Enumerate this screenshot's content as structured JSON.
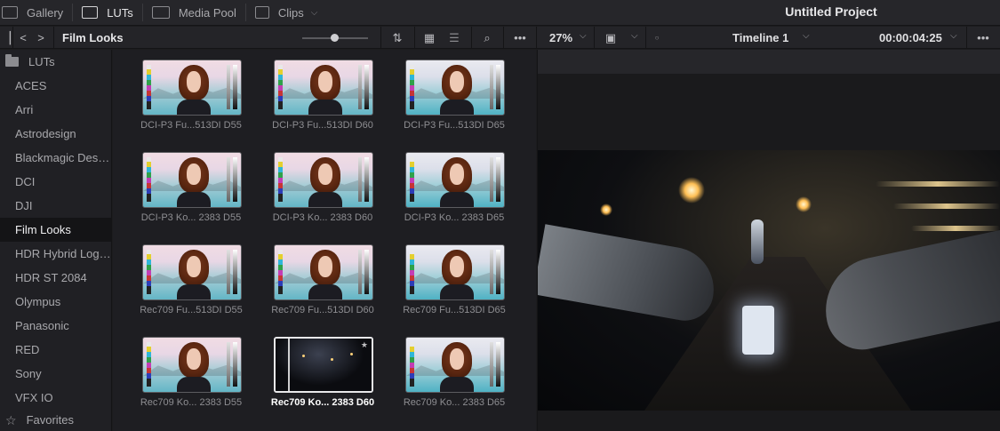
{
  "topbar": {
    "tabs": [
      {
        "label": "Gallery",
        "icon": "gallery-icon"
      },
      {
        "label": "LUTs",
        "icon": "luts-icon"
      },
      {
        "label": "Media Pool",
        "icon": "media-pool-icon"
      },
      {
        "label": "Clips",
        "icon": "clips-icon"
      }
    ],
    "project_title": "Untitled Project"
  },
  "toolbar": {
    "current_folder": "Film Looks",
    "zoom": "27%",
    "timeline": "Timeline 1",
    "timecode": "00:00:04:25",
    "more": "•••",
    "back": "<",
    "forward": ">",
    "sort": "⇅",
    "grid_view": "▦",
    "list_view": "☰",
    "search": "⌕",
    "chevron": "⌵"
  },
  "sidebar": {
    "root": "LUTs",
    "items": [
      "ACES",
      "Arri",
      "Astrodesign",
      "Blackmagic Design",
      "DCI",
      "DJI",
      "Film Looks",
      "HDR Hybrid Log-Gamma",
      "HDR ST 2084",
      "Olympus",
      "Panasonic",
      "RED",
      "Sony",
      "VFX IO"
    ],
    "active": "Film Looks",
    "favorites": "Favorites"
  },
  "luts": [
    {
      "label": "DCI-P3 Fu...513DI D55",
      "style": "warm",
      "selected": false
    },
    {
      "label": "DCI-P3 Fu...513DI D60",
      "style": "warm",
      "selected": false
    },
    {
      "label": "DCI-P3 Fu...513DI D65",
      "style": "cool",
      "selected": false
    },
    {
      "label": "DCI-P3 Ko... 2383 D55",
      "style": "warm",
      "selected": false
    },
    {
      "label": "DCI-P3 Ko... 2383 D60",
      "style": "warm",
      "selected": false
    },
    {
      "label": "DCI-P3 Ko... 2383 D65",
      "style": "cool",
      "selected": false
    },
    {
      "label": "Rec709 Fu...513DI D55",
      "style": "warm",
      "selected": false
    },
    {
      "label": "Rec709 Fu...513DI D60",
      "style": "warm",
      "selected": false
    },
    {
      "label": "Rec709 Fu...513DI D65",
      "style": "cool",
      "selected": false
    },
    {
      "label": "Rec709 Ko... 2383 D55",
      "style": "warm",
      "selected": false
    },
    {
      "label": "Rec709 Ko... 2383 D60",
      "style": "dark",
      "selected": true
    },
    {
      "label": "Rec709 Ko... 2383 D65",
      "style": "cool",
      "selected": false
    }
  ],
  "colors": {
    "background": "#1c1c1e",
    "selected_border": "#e8e8ea",
    "text_primary": "#e6e6e8",
    "text_secondary": "#8e8e92"
  }
}
